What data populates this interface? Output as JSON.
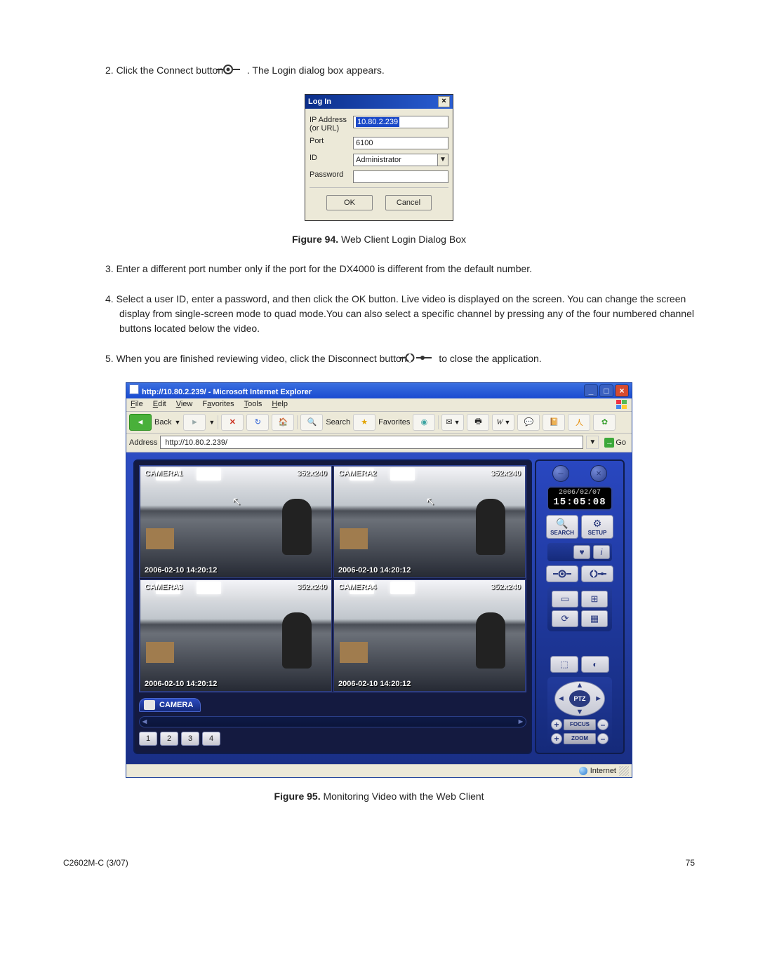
{
  "steps": {
    "s2a": "2.   Click the Connect button",
    "s2b": ". The Login dialog box appears.",
    "s3": "3.   Enter a different port number only if the port for the DX4000 is different from the default number.",
    "s4": "4.   Select a user ID, enter a password, and then click the OK button. Live video is displayed on the screen. You can change the screen display from single-screen mode to quad mode.You can also select a specific channel by pressing any of the four numbered channel buttons located below the video.",
    "s5a": "5.   When you are finished reviewing video, click the Disconnect button",
    "s5b": "to close the application."
  },
  "captions": {
    "fig94_b": "Figure 94.",
    "fig94_t": "  Web Client Login Dialog Box",
    "fig95_b": "Figure 95.",
    "fig95_t": "  Monitoring Video with the Web Client"
  },
  "login": {
    "title": "Log In",
    "ip_label": "IP Address (or URL)",
    "ip_value": "10.80.2.239",
    "port_label": "Port",
    "port_value": "6100",
    "id_label": "ID",
    "id_value": "Administrator",
    "pw_label": "Password",
    "ok": "OK",
    "cancel": "Cancel"
  },
  "ie": {
    "title": "http://10.80.2.239/ - Microsoft Internet Explorer",
    "menu": {
      "file": "File",
      "edit": "Edit",
      "view": "View",
      "favorites": "Favorites",
      "tools": "Tools",
      "help": "Help"
    },
    "toolbar": {
      "back": "Back",
      "search": "Search",
      "favorites": "Favorites"
    },
    "addr_label": "Address",
    "url": "http://10.80.2.239/",
    "go": "Go",
    "status_zone": "Internet"
  },
  "client": {
    "cameras": [
      {
        "name": "CAMERA1",
        "res": "352x240",
        "ts": "2006-02-10 14:20:12"
      },
      {
        "name": "CAMERA2",
        "res": "352x240",
        "ts": "2006-02-10 14:20:12"
      },
      {
        "name": "CAMERA3",
        "res": "352x240",
        "ts": "2006-02-10 14:20:12"
      },
      {
        "name": "CAMERA4",
        "res": "352x240",
        "ts": "2006-02-10 14:20:12"
      }
    ],
    "camera_label": "CAMERA",
    "channels": [
      "1",
      "2",
      "3",
      "4"
    ],
    "date": "2006/02/07",
    "time": "15:05:08",
    "search": "SEARCH",
    "setup": "SETUP",
    "ptz": "PTZ",
    "focus": "FOCUS",
    "zoom": "ZOOM"
  },
  "footer": {
    "left": "C2602M-C (3/07)",
    "right": "75"
  }
}
